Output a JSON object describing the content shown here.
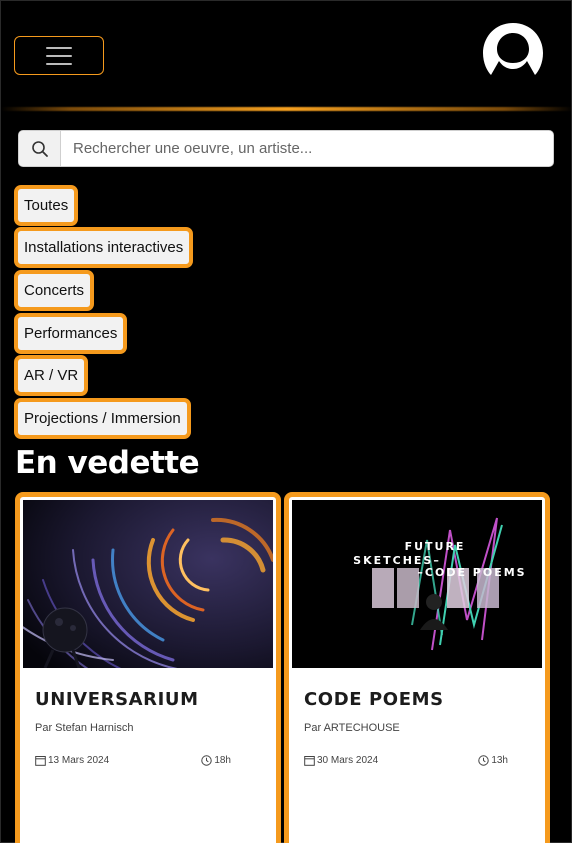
{
  "navbar": {
    "menu_button": "hamburger-menu",
    "logo": "arc-logo"
  },
  "search": {
    "placeholder": "Rechercher une oeuvre, un artiste...",
    "value": ""
  },
  "filters": [
    {
      "label": "Toutes"
    },
    {
      "label": "Installations interactives"
    },
    {
      "label": "Concerts"
    },
    {
      "label": "Performances"
    },
    {
      "label": "AR / VR"
    },
    {
      "label": "Projections / Immersion"
    }
  ],
  "featured": {
    "title": "En vedette",
    "cards": [
      {
        "title": "UNIVERSARIUM",
        "author": "Par Stefan Harnisch",
        "date": "13 Mars 2024",
        "time": "18h"
      },
      {
        "title": "CODE POEMS",
        "author": "Par ARTECHOUSE",
        "date": "30 Mars 2024",
        "time": "13h",
        "poster_text": [
          "FUTURE",
          "SKETCHES–",
          "–CODE POEMS"
        ]
      }
    ]
  },
  "colors": {
    "accent": "#f59a1d",
    "background": "#000000",
    "chip_bg": "#f2f2f2"
  },
  "icons": [
    "menu-icon",
    "logo-icon",
    "search-icon",
    "calendar-icon",
    "clock-icon"
  ]
}
